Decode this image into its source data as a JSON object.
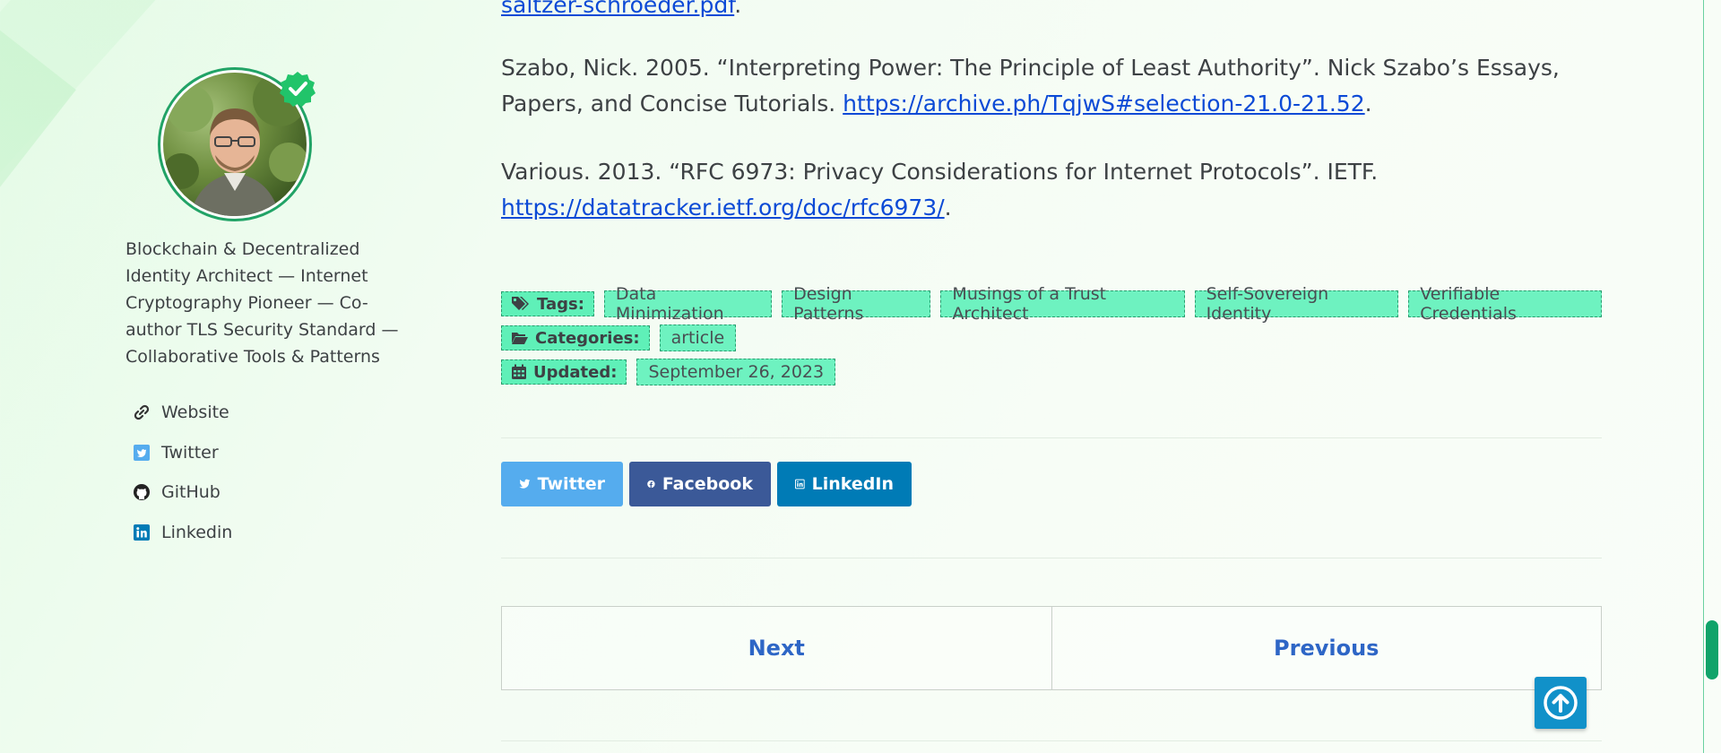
{
  "sidebar": {
    "bio": "Blockchain & Decentralized Identity Architect — Internet Cryptography Pioneer — Co-author TLS Security Standard — Collaborative Tools & Patterns",
    "links": [
      {
        "label": "Website",
        "icon": "link-icon"
      },
      {
        "label": "Twitter",
        "icon": "twitter-icon"
      },
      {
        "label": "GitHub",
        "icon": "github-icon"
      },
      {
        "label": "Linkedin",
        "icon": "linkedin-icon"
      }
    ]
  },
  "references": {
    "top_link": "saltzer-schroeder.pdf",
    "ref1": {
      "text": "Szabo, Nick. 2005. “Interpreting Power: The Principle of Least Authority”. Nick Szabo’s Essays, Papers, and Concise Tutorials. ",
      "link": "https://archive.ph/TqjwS#selection-21.0-21.52"
    },
    "ref2": {
      "text": "Various. 2013. “RFC 6973: Privacy Considerations for Internet Protocols”. IETF. ",
      "link": "https://datatracker.ietf.org/doc/rfc6973/"
    }
  },
  "taxonomy": {
    "tags_label": "Tags:",
    "tags": [
      "Data Minimization",
      "Design Patterns",
      "Musings of a Trust Architect",
      "Self-Sovereign Identity",
      "Verifiable Credentials"
    ],
    "categories_label": "Categories:",
    "categories": [
      "article"
    ],
    "updated_label": "Updated:",
    "updated_value": "September 26, 2023"
  },
  "share": {
    "twitter": "Twitter",
    "facebook": "Facebook",
    "linkedin": "LinkedIn"
  },
  "pager": {
    "next": "Next",
    "previous": "Previous"
  },
  "colors": {
    "link": "#0c4ad6",
    "tag_bg": "#6ef2c0",
    "twitter": "#55acee",
    "facebook": "#3b5998",
    "linkedin": "#007bb6",
    "pager_text": "#2e66c6",
    "to_top": "#1191c9",
    "verified": "#21c46a"
  }
}
